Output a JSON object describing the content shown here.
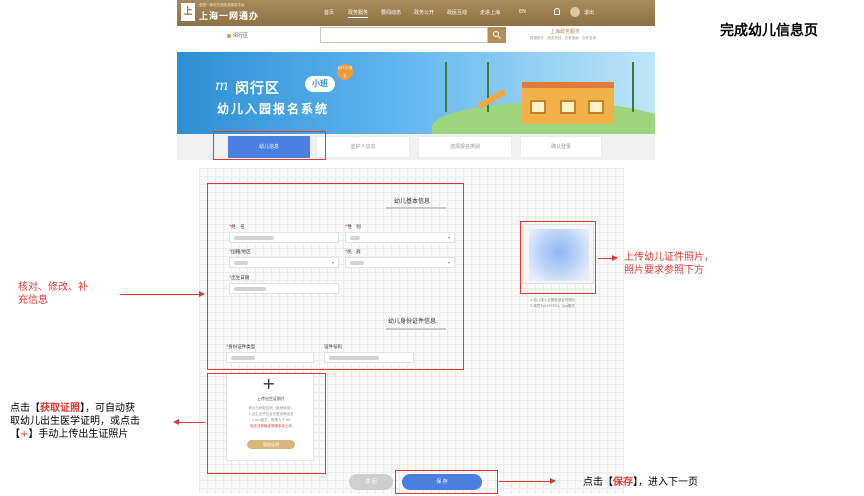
{
  "page_heading": "完成幼儿信息页",
  "topbar": {
    "logo_char": "上",
    "logo_sub": "全国一体化在线政务服务平台",
    "logo_title": "上海一网通办",
    "nav": [
      "首页",
      "政务服务",
      "要闻动态",
      "政务公开",
      "政民互动",
      "走进上海",
      "EN"
    ],
    "nav_active": "政务服务",
    "user_action": "退出"
  },
  "search": {
    "location": "闵行区",
    "placeholder": "",
    "city_title": "上海政务服务",
    "city_sub": "数据统计 · 政务热线 · 办事指南 · 办件查询"
  },
  "banner": {
    "brush": "m",
    "line1_prefix": "闵行区",
    "badge": "小班",
    "tag": "幼升小 报名",
    "line2": "幼儿入园报名系统"
  },
  "steps": [
    {
      "label": "幼儿信息",
      "active": true
    },
    {
      "label": "监护人信息",
      "active": false
    },
    {
      "label": "选择报名类别",
      "active": false
    },
    {
      "label": "确认登录",
      "active": false
    }
  ],
  "form": {
    "basic_title": "幼儿基本信息",
    "fields": {
      "name_label": "姓　名",
      "gender_label": "性　别",
      "nationality_label": "国籍/地区",
      "ethnicity_label": "民　族",
      "birthdate_label": "出生日期"
    },
    "id_title": "幼儿身份证件信息",
    "id_type_label": "身份证件类型",
    "id_number_label": "证件号码"
  },
  "photo": {
    "hint1": "1.幼儿本人近期免冠证件照片",
    "hint2": "2.请意为413*354，jpg格式"
  },
  "birth_cert": {
    "plus": "+",
    "title": "上传出生证照片",
    "note1": "请点击获取证明（推荐使用）",
    "note2": "1.出生证须包含完整准确信息",
    "note3": "2.jpg格式，像素大于1M",
    "note_red": "如无法获取证明请手动上传",
    "button": "获取证明"
  },
  "buttons": {
    "back": "返 回",
    "save": "保 存"
  },
  "annotations": {
    "photo": "上传幼儿证件照片，\n照片要求参照下方",
    "verify": "核对、修改、补\n充信息",
    "cert_1": "点击【",
    "cert_bold": "获取证照",
    "cert_2": "】，可自动获\n取幼儿出生医学证明，或点击\n【",
    "cert_plus": "+",
    "cert_3": "】手动上传出生证照片",
    "save_1": "点击【",
    "save_bold": "保存",
    "save_2": "】，进入下一页"
  }
}
